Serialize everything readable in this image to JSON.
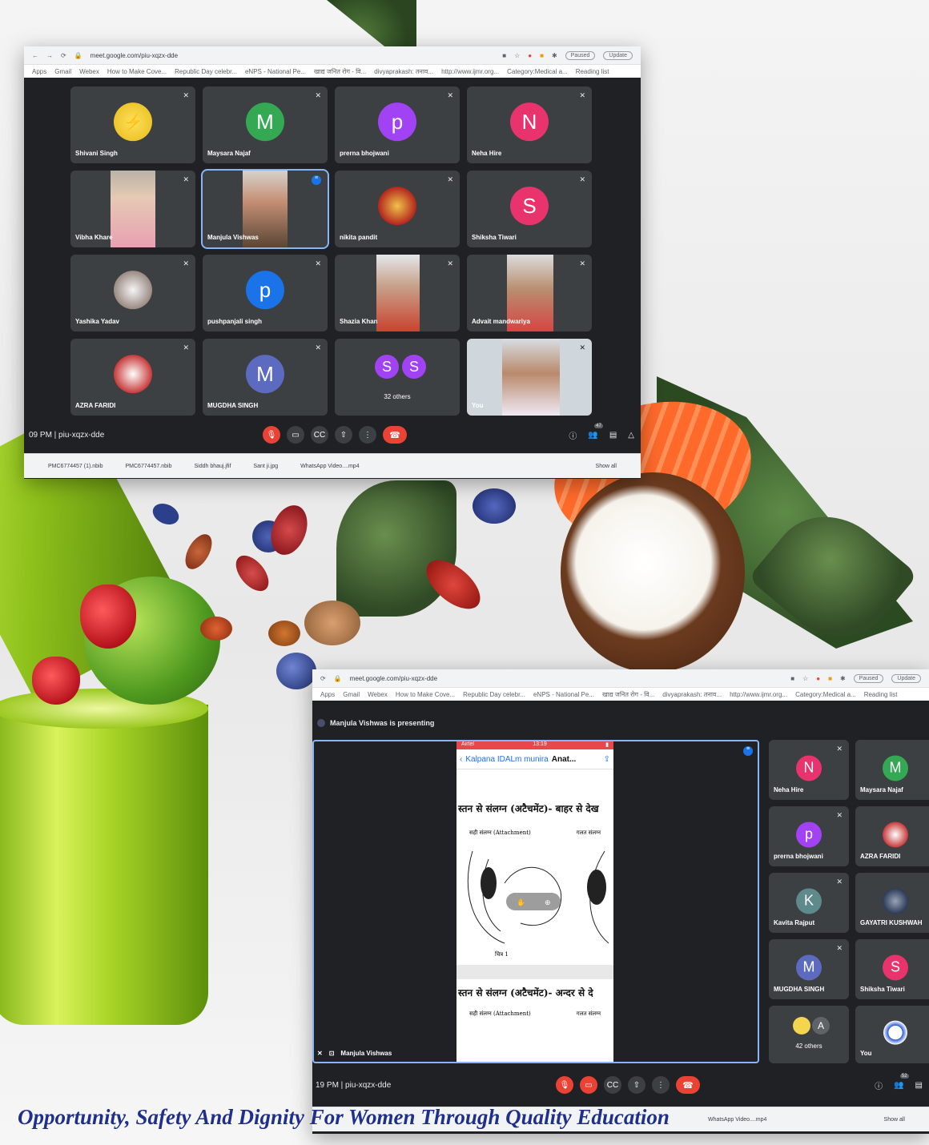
{
  "colors": {
    "meet_bg": "#202124",
    "tile_bg": "#3c4043",
    "end_call": "#ea4335",
    "tagline": "#1f2f8c",
    "speaking_outline": "#8ab4f8"
  },
  "tagline": "Opportunity, Safety And Dignity For Women Through Quality Education",
  "top_window": {
    "url": "meet.google.com/piu-xqzx-dde",
    "profile_label": "Paused",
    "update_label": "Update",
    "bookmarks": [
      "Apps",
      "Gmail",
      "Webex",
      "How to Make Cove...",
      "Republic Day celebr...",
      "eNPS - National Pe...",
      "खाद्य जनित रोग - वि...",
      "divyaprakash: तनाव...",
      "http://www.ijmr.org...",
      "Category:Medical a...",
      "Reading list"
    ],
    "tiles": [
      {
        "name": "Shivani Singh",
        "initial": "",
        "avatar": "pikachu-avatar",
        "color": "#f3d54e"
      },
      {
        "name": "Maysara Najaf",
        "initial": "M",
        "color": "#34a853"
      },
      {
        "name": "prerna bhojwani",
        "initial": "p",
        "color": "#a142f4"
      },
      {
        "name": "Neha Hire",
        "initial": "N",
        "color": "#e8336d"
      },
      {
        "name": "Vibha Khare",
        "initial": "",
        "avatar": "video"
      },
      {
        "name": "Manjula Vishwas",
        "initial": "",
        "avatar": "video"
      },
      {
        "name": "nikita pandit",
        "initial": "",
        "avatar": "deity-avatar"
      },
      {
        "name": "Shiksha Tiwari",
        "initial": "S",
        "color": "#e8336d"
      },
      {
        "name": "Yashika Yadav",
        "initial": "",
        "avatar": "photo-avatar"
      },
      {
        "name": "pushpanjali singh",
        "initial": "p",
        "color": "#1a73e8"
      },
      {
        "name": "Shazia Khan",
        "initial": "",
        "avatar": "video"
      },
      {
        "name": "Advait mandwariya",
        "initial": "",
        "avatar": "video"
      },
      {
        "name": "AZRA FARIDI",
        "initial": "",
        "avatar": "photo-avatar"
      },
      {
        "name": "MUGDHA SINGH",
        "initial": "M",
        "color": "#5c6bc0"
      },
      {
        "name": "32 others",
        "initial": "S",
        "color": "#a142f4"
      },
      {
        "name": "You",
        "initial": "",
        "avatar": "video"
      }
    ],
    "others_initials": [
      "S",
      "S"
    ],
    "time_meeting": "09 PM | piu-xqzx-dde",
    "participants_badge": "47",
    "downloads": [
      "PMC6774457 (1).nbib",
      "PMC6774457.nbib",
      "Siddh bhauj.jfif",
      "Sant ji.jpg",
      "WhatsApp Video....mp4"
    ],
    "show_all": "Show all"
  },
  "bottom_window": {
    "url": "meet.google.com/piu-xqzx-dde",
    "profile_label": "Paused",
    "update_label": "Update",
    "bookmarks": [
      "Apps",
      "Gmail",
      "Webex",
      "How to Make Cove...",
      "Republic Day celebr...",
      "eNPS - National Pe...",
      "खाद्य जनित रोग - वि...",
      "divyaprakash: तनाव...",
      "http://www.ijmr.org...",
      "Category:Medical a...",
      "Reading list"
    ],
    "presenting_banner": "Manjula Vishwas is presenting",
    "phone": {
      "carrier": "Airtel",
      "time": "13:19",
      "back_label": "Kalpana IDALm munira",
      "title": "Anat...",
      "heading1": "स्तन से संलग्न (अटैचमेंट)- बाहर से देख",
      "col_left1": "सही संलग्न (Attachment)",
      "col_right1": "गलत संलग्न",
      "caption1": "चित्र 1",
      "heading2": "स्तन से संलग्न (अटैचमेंट)- अन्दर से दे",
      "col_left2": "सही संलग्न (Attachment)",
      "col_right2": "गलत संलग्न"
    },
    "presenter_label": "Manjula Vishwas",
    "side_tiles": [
      {
        "name": "Neha Hire",
        "initial": "N",
        "color": "#e8336d"
      },
      {
        "name": "Maysara Najaf",
        "initial": "M",
        "color": "#34a853"
      },
      {
        "name": "prerna bhojwani",
        "initial": "p",
        "color": "#a142f4"
      },
      {
        "name": "AZRA FARIDI",
        "initial": "",
        "avatar": "photo-avatar"
      },
      {
        "name": "Kavita Rajput",
        "initial": "K",
        "color": "#5f8a8b"
      },
      {
        "name": "GAYATRI KUSHWAH",
        "initial": "",
        "avatar": "photo-avatar"
      },
      {
        "name": "MUGDHA SINGH",
        "initial": "M",
        "color": "#5c6bc0"
      },
      {
        "name": "Shiksha Tiwari",
        "initial": "S",
        "color": "#e8336d"
      },
      {
        "name": "42 others",
        "initial": "A",
        "color": "#5f6368"
      },
      {
        "name": "You",
        "initial": "",
        "avatar": "logo-avatar"
      }
    ],
    "time_meeting": "19 PM | piu-xqzx-dde",
    "participants_badge": "52",
    "downloads": [
      "WhatsApp Video....mp4"
    ],
    "show_all": "Show all"
  }
}
